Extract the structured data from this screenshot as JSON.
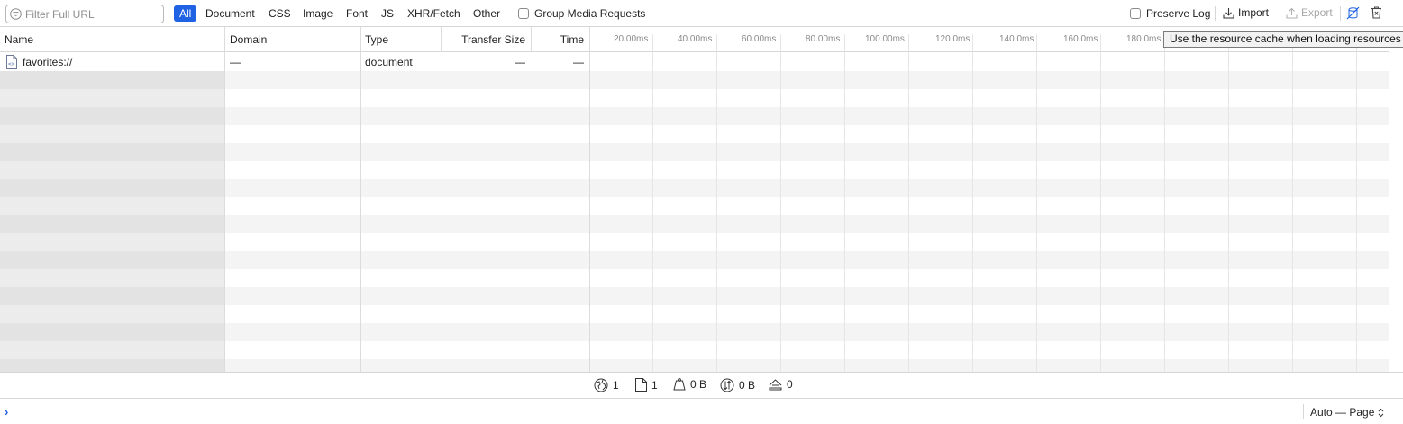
{
  "toolbar": {
    "filter_placeholder": "Filter Full URL",
    "scopes": [
      "All",
      "Document",
      "CSS",
      "Image",
      "Font",
      "JS",
      "XHR/Fetch",
      "Other"
    ],
    "group_media_label": "Group Media Requests",
    "preserve_log_label": "Preserve Log",
    "import_label": "Import",
    "export_label": "Export"
  },
  "table": {
    "columns": [
      "Name",
      "Domain",
      "Type",
      "Transfer Size",
      "Time"
    ],
    "timeline_ticks": [
      "20.00ms",
      "40.00ms",
      "60.00ms",
      "80.00ms",
      "100.00ms",
      "120.0ms",
      "140.0ms",
      "160.0ms",
      "180.0ms"
    ],
    "rows": [
      {
        "name": "favorites://",
        "domain": "—",
        "type": "document",
        "transfer_size": "—",
        "time": "—"
      }
    ]
  },
  "tooltip": "Use the resource cache when loading resources",
  "statusbar": {
    "requests": "1",
    "documents": "1",
    "transferred": "0 B",
    "resources": "0 B",
    "redirects": "0"
  },
  "console": {
    "context": "Auto — Page"
  },
  "colors": {
    "accent": "#1f62e3"
  }
}
